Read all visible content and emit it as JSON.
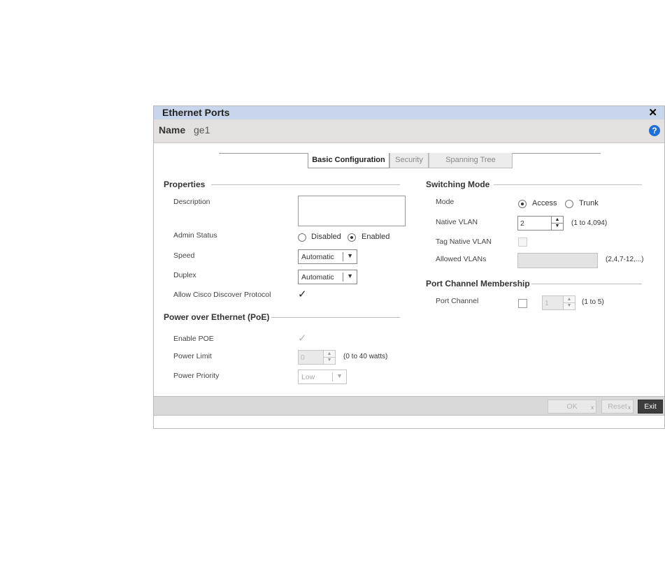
{
  "dialog": {
    "title": "Ethernet Ports",
    "close_icon": "close-icon",
    "name_label": "Name",
    "name_value": "ge1",
    "help_glyph": "?"
  },
  "tabs": [
    {
      "label": "Basic Configuration",
      "active": true
    },
    {
      "label": "Security",
      "active": false
    },
    {
      "label": "Spanning Tree",
      "active": false
    }
  ],
  "properties": {
    "heading": "Properties",
    "description_label": "Description",
    "description_value": "",
    "admin_status_label": "Admin Status",
    "admin_disabled": "Disabled",
    "admin_enabled": "Enabled",
    "admin_selected": "Enabled",
    "speed_label": "Speed",
    "speed_value": "Automatic",
    "duplex_label": "Duplex",
    "duplex_value": "Automatic",
    "cdp_label": "Allow Cisco Discover Protocol",
    "cdp_checked": true
  },
  "poe": {
    "heading": "Power over Ethernet (PoE)",
    "enable_label": "Enable POE",
    "enable_checked": true,
    "power_limit_label": "Power Limit",
    "power_limit_value": "0",
    "power_limit_hint": "(0 to 40 watts)",
    "power_priority_label": "Power Priority",
    "power_priority_value": "Low"
  },
  "switching": {
    "heading": "Switching Mode",
    "mode_label": "Mode",
    "mode_access": "Access",
    "mode_trunk": "Trunk",
    "mode_selected": "Access",
    "native_vlan_label": "Native VLAN",
    "native_vlan_value": "2",
    "native_vlan_hint": "(1 to 4,094)",
    "tag_native_label": "Tag Native VLAN",
    "tag_native_checked": false,
    "allowed_vlans_label": "Allowed VLANs",
    "allowed_vlans_value": "",
    "allowed_vlans_hint": "(2,4,7-12,...)"
  },
  "port_channel": {
    "heading": "Port Channel Membership",
    "label": "Port Channel",
    "checked": false,
    "value": "1",
    "hint": "(1 to 5)"
  },
  "footer": {
    "ok_label": "OK",
    "reset_label": "Reset",
    "exit_label": "Exit"
  }
}
